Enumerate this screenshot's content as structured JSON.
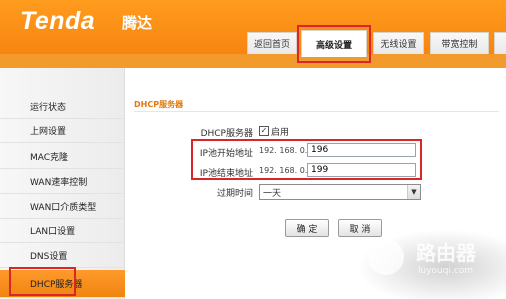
{
  "header": {
    "logo_en": "Tenda",
    "logo_cn": "腾达"
  },
  "tabs": [
    {
      "label": "返回首页",
      "active": false
    },
    {
      "label": "高级设置",
      "active": true
    },
    {
      "label": "无线设置",
      "active": false
    },
    {
      "label": "带宽控制",
      "active": false
    }
  ],
  "sidebar": {
    "items": [
      {
        "label": "运行状态"
      },
      {
        "label": "上网设置"
      },
      {
        "label": "MAC克隆"
      },
      {
        "label": "WAN速率控制"
      },
      {
        "label": "WAN口介质类型"
      },
      {
        "label": "LAN口设置"
      },
      {
        "label": "DNS设置"
      },
      {
        "label": "DHCP服务器",
        "active": true
      }
    ]
  },
  "main": {
    "section_title": "DHCP服务器",
    "dhcp_server_label": "DHCP服务器",
    "enable_label": "启用",
    "enabled": true,
    "start_label": "IP池开始地址",
    "start_prefix": "192. 168. 0.",
    "start_value": "196",
    "end_label": "IP池结束地址",
    "end_prefix": "192. 168. 0.",
    "end_value": "199",
    "lease_label": "过期时间",
    "lease_value": "一天",
    "ok_button": "确 定",
    "cancel_button": "取 消"
  },
  "watermark": {
    "cn": "路由器",
    "en": "luyouqi.com"
  },
  "colors": {
    "brand_orange": "#f78510",
    "highlight_red": "#d8262a"
  }
}
